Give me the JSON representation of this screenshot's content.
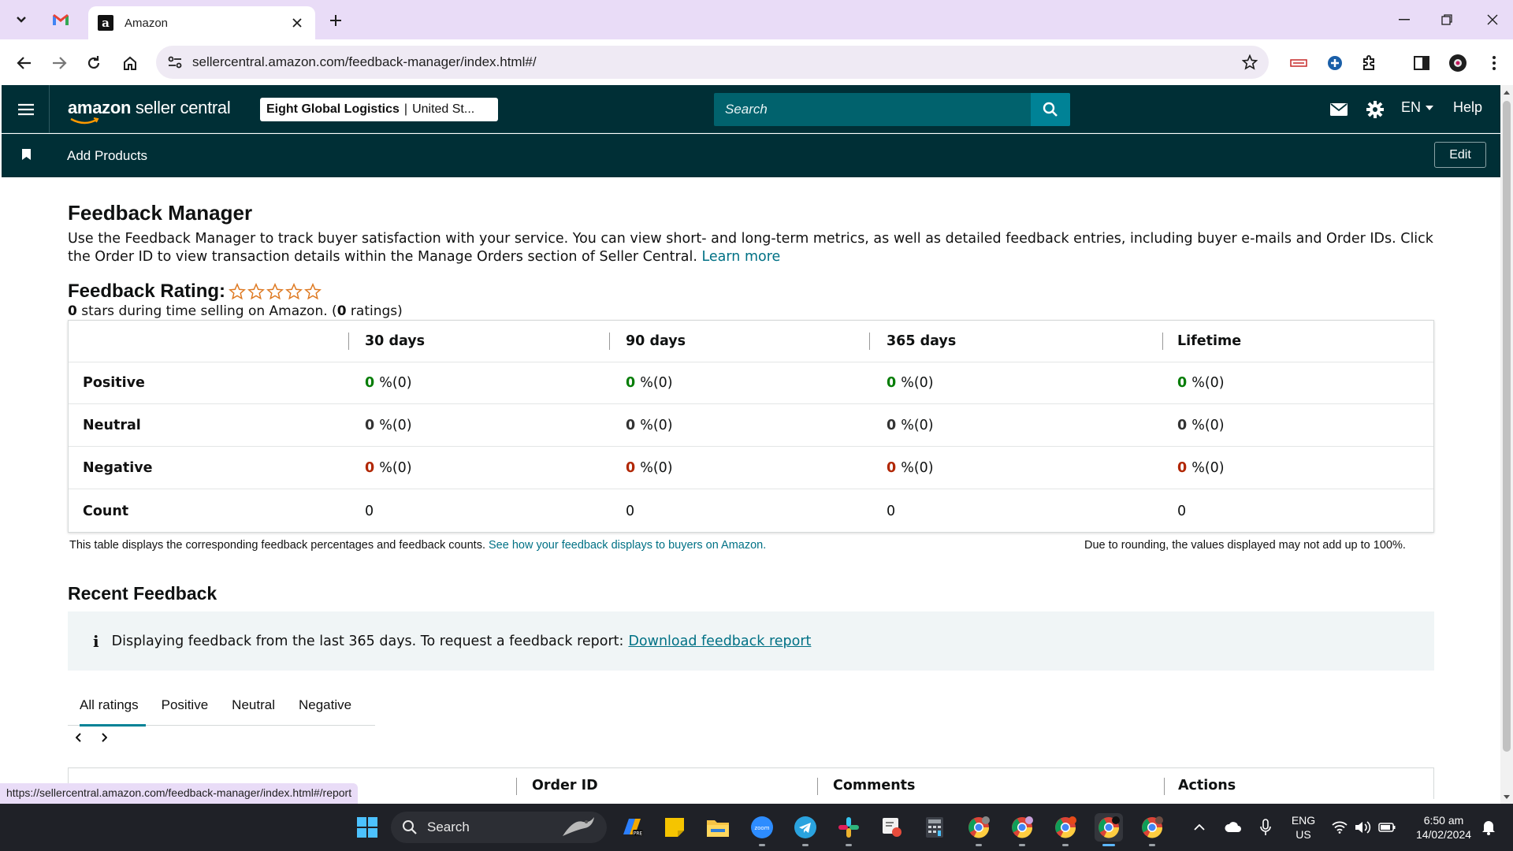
{
  "browser": {
    "tab_title": "Amazon",
    "url": "sellercentral.amazon.com/feedback-manager/index.html#/",
    "status_url": "https://sellercentral.amazon.com/feedback-manager/index.html#/report"
  },
  "header": {
    "logo_bold": "amazon",
    "logo_rest": " seller central",
    "store_name": "Eight Global Logistics",
    "store_region": "United St...",
    "search_placeholder": "Search",
    "language": "EN",
    "help_label": "Help",
    "bookmark_label": "Add Products",
    "edit_label": "Edit"
  },
  "page": {
    "title": "Feedback Manager",
    "intro": "Use the Feedback Manager to track buyer satisfaction with your service. You can view short- and long-term metrics, as well as detailed feedback entries, including buyer e-mails and Order IDs. Click the Order ID to view transaction details within the Manage Orders section of Seller Central.",
    "learn_more": "Learn more",
    "rating_title": "Feedback Rating:",
    "rating_stars": 0,
    "rating_sub_value": "0",
    "rating_sub_text": " stars during time selling on Amazon. (",
    "rating_count": "0",
    "rating_sub_tail": " ratings)"
  },
  "feedback_table": {
    "columns": [
      "30 days",
      "90 days",
      "365 days",
      "Lifetime"
    ],
    "rows": [
      {
        "label": "Positive",
        "values": [
          "0",
          "0",
          "0",
          "0"
        ],
        "counts": [
          "%(0)",
          "%(0)",
          "%(0)",
          "%(0)"
        ],
        "color": "#067d07"
      },
      {
        "label": "Neutral",
        "values": [
          "0",
          "0",
          "0",
          "0"
        ],
        "counts": [
          "%(0)",
          "%(0)",
          "%(0)",
          "%(0)"
        ],
        "color": "#333333"
      },
      {
        "label": "Negative",
        "values": [
          "0",
          "0",
          "0",
          "0"
        ],
        "counts": [
          "%(0)",
          "%(0)",
          "%(0)",
          "%(0)"
        ],
        "color": "#b12704"
      },
      {
        "label": "Count",
        "values": [
          "0",
          "0",
          "0",
          "0"
        ]
      }
    ],
    "note": "This table displays the corresponding feedback percentages and feedback counts.",
    "note_link": "See how your feedback displays to buyers on Amazon.",
    "note_right": "Due to rounding, the values displayed may not add up to 100%."
  },
  "recent": {
    "title": "Recent Feedback",
    "info_text": "Displaying feedback from the last 365 days. To request a feedback report:",
    "info_link": "Download feedback report",
    "tabs": [
      "All ratings",
      "Positive",
      "Neutral",
      "Negative"
    ],
    "list_columns": [
      "Order ID",
      "Comments",
      "Actions"
    ]
  },
  "taskbar": {
    "search_label": "Search",
    "lang_top": "ENG",
    "lang_bottom": "US",
    "time": "6:50 am",
    "date": "14/02/2024"
  },
  "colors": {
    "header_bg": "#002f36",
    "accent": "#008296",
    "link": "#007185",
    "positive": "#067d07",
    "negative": "#b12704"
  }
}
